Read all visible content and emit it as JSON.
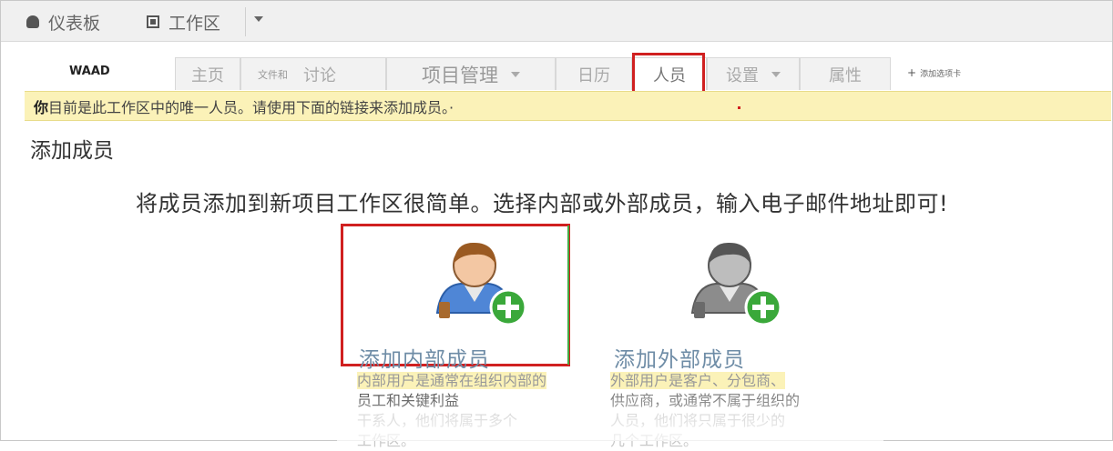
{
  "topbar": {
    "dashboard_label": "仪表板",
    "workspace_label": "工作区"
  },
  "workspace_name": "WAAD",
  "tabs": [
    {
      "label": "主页"
    },
    {
      "prefix": "文件和",
      "label": "讨论"
    },
    {
      "label": "项目管理"
    },
    {
      "label": "日历"
    },
    {
      "label": "人员"
    },
    {
      "label": "设置"
    },
    {
      "label": "属性"
    }
  ],
  "add_tab_label": "添加选项卡",
  "notice": {
    "bold": "你",
    "text": "目前是此工作区中的唯一人员。请使用下面的链接来添加成员。·"
  },
  "heading": "添加成员",
  "intro": "将成员添加到新项目工作区很简单。选择内部或外部成员，输入电子邮件地址即可!",
  "internal": {
    "title": "添加内部成员",
    "desc_line1": "内部用户是通常在组织内部的",
    "desc_line2": "员工和关键利益",
    "desc_line3": "干系人，他们将属于多个",
    "desc_line4": "工作区。"
  },
  "external": {
    "title": "添加外部成员",
    "desc_line1": "外部用户是客户、分包商、",
    "desc_line2": "供应商，或通常不属于组织的",
    "desc_line3": "人员，他们将只属于很少的",
    "desc_line4": "几个工作区。"
  },
  "colors": {
    "accent_red": "#d02020",
    "notice_bg": "#fbf2b8",
    "title_blue": "#6e8ca6",
    "plus_green": "#3aa83a"
  }
}
